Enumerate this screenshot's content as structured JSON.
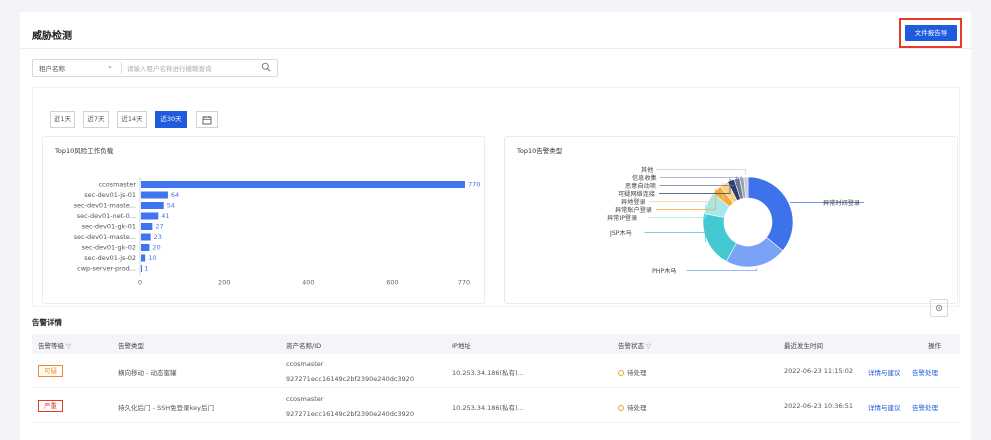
{
  "page": {
    "title": "威胁检测",
    "export_label": "文件报告导"
  },
  "filter": {
    "select_value": "租户名称",
    "placeholder": "请输入租户名称进行模糊查询"
  },
  "ranges": [
    "近1天",
    "近7天",
    "近14天",
    "近30天"
  ],
  "active_range": 3,
  "bar_card": {
    "title": "Top10风险工作负载"
  },
  "donut_card": {
    "title": "Top10告警类型"
  },
  "chart_data": [
    {
      "type": "bar",
      "orientation": "horizontal",
      "title": "Top10风险工作负载",
      "categories": [
        "ccosmaster",
        "sec-dev01-js-01",
        "sec-dev01-maste...",
        "sec-dev01-net-0...",
        "sec-dev01-gk-01",
        "sec-dev01-maste...",
        "sec-dev01-gk-02",
        "sec-dev01-js-02",
        "cwp-server-prod..."
      ],
      "values": [
        770,
        64,
        54,
        41,
        27,
        23,
        20,
        10,
        1
      ],
      "x_ticks": [
        0,
        200,
        400,
        600,
        770
      ],
      "xlim": [
        0,
        770
      ],
      "grid": false,
      "color": "#3f76ef"
    },
    {
      "type": "pie",
      "donut": true,
      "title": "Top10告警类型",
      "labels": [
        "异常时间登录",
        "PHP木马",
        "JSP木马",
        "异常IP登录",
        "异常账户登录",
        "异地登录",
        "可疑网络连接",
        "恶意自动项",
        "信息收集",
        "其他"
      ],
      "values": [
        36,
        22,
        20,
        8,
        3.5,
        3,
        2.5,
        2,
        1.5,
        1.5
      ],
      "colors": [
        "#3e72ea",
        "#7ba3f5",
        "#44c8d2",
        "#a6e7ec",
        "#f4a93b",
        "#f9d184",
        "#2e3d6b",
        "#6c7a95",
        "#9aa4b8",
        "#c7ccd6"
      ]
    }
  ],
  "alerts": {
    "title": "告警详情",
    "columns": [
      "告警等级",
      "告警类型",
      "资产名称/ID",
      "IP地址",
      "告警状态",
      "最近发生时间",
      "操作"
    ],
    "rows": [
      {
        "level": "可疑",
        "level_color": "#f08a24",
        "type": "横向移动 - 动态蜜罐",
        "asset_name": "ccosmaster",
        "asset_id": "927271ecc16149c2bf2390e240dc3920",
        "ip": "10.253.34.186(私有)...",
        "status": "待处理",
        "time": "2022-06-23 11:15:02",
        "action_detail": "详情与建议",
        "action_handle": "告警处理"
      },
      {
        "level": "严重",
        "level_color": "#e5392a",
        "type": "持久化后门 - SSH免登录key后门",
        "asset_name": "ccosmaster",
        "asset_id": "927271ecc16149c2bf2390e240dc3920",
        "ip": "10.253.34.186(私有)...",
        "status": "待处理",
        "time": "2022-06-23 10:36:51",
        "action_detail": "详情与建议",
        "action_handle": "告警处理"
      }
    ]
  }
}
